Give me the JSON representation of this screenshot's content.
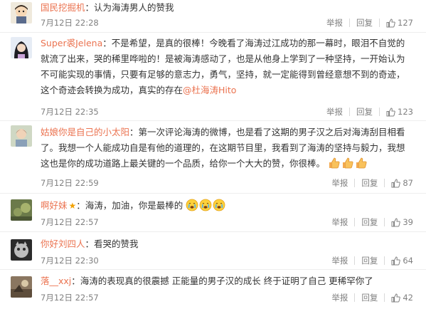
{
  "action_labels": {
    "report": "举报",
    "reply": "回复"
  },
  "colors": {
    "username": "#eb7350",
    "text": "#333333",
    "meta": "#808080"
  },
  "comments": [
    {
      "username": "国民挖掘机",
      "content": "认为海涛男人的赞我",
      "time": "7月12日 22:28",
      "likes": "127"
    },
    {
      "username": "Super裘Jelena",
      "content": "不是希望，是真的很棒！今晚看了海涛过江成功的那一幕时，眼泪不自觉的就流了出来，哭的稀里哗啦的！是被海涛感动了，也是从他身上学到了一种坚持，一开始认为不可能实现的事情，只要有足够的意志力，勇气，坚持，就一定能得到曾经意想不到的奇迹，这个奇迹会转换为成功，真实的存在",
      "mention": "@杜海涛Hito",
      "time": "7月12日 22:35",
      "likes": "123"
    },
    {
      "username": "姑娘你是自己的小太阳",
      "content": "第一次评论海涛的微博，也是看了这期的男子汉之后对海涛刮目相看了。我想一个人能成功自是有他的道理的，在这期节目里，我看到了海涛的坚持与毅力，我想这也是你的成功道路上最关键的一个品质，给你一个大大的赞，你很棒。",
      "emojis": [
        "thumbs-up-emoji",
        "thumbs-up-emoji",
        "thumbs-up-emoji"
      ],
      "time": "7月12日 22:59",
      "likes": "87"
    },
    {
      "username": "啊好妹",
      "badge": "★",
      "content": "海涛，加油，你是最棒的",
      "emojis": [
        "crying-emoji",
        "crying-emoji",
        "crying-emoji"
      ],
      "time": "7月12日 22:57",
      "likes": "39"
    },
    {
      "username": "你好刘四人",
      "content": "看哭的赞我",
      "time": "7月12日 22:30",
      "likes": "64"
    },
    {
      "username": "落__xxj",
      "content": "海涛的表现真的很震撼 正能量的男子汉的成长 终于证明了自己 更稀罕你了",
      "time": "7月12日 22:57",
      "likes": "42"
    }
  ]
}
